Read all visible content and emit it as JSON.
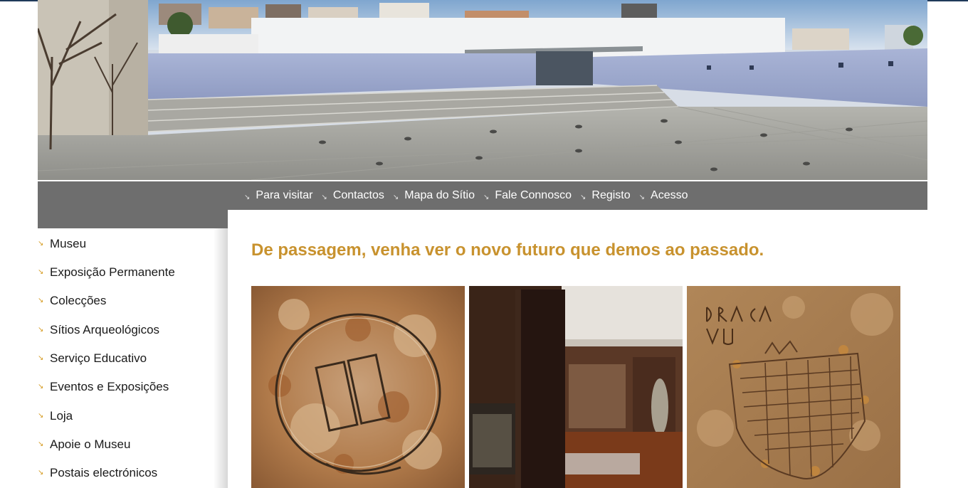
{
  "nav": {
    "items": [
      {
        "label": "Para visitar"
      },
      {
        "label": "Contactos"
      },
      {
        "label": "Mapa do Sítio"
      },
      {
        "label": "Fale Connosco"
      },
      {
        "label": "Registo"
      },
      {
        "label": "Acesso"
      }
    ],
    "bullet_icon": "arrow-bullet-icon"
  },
  "sidebar": {
    "items": [
      {
        "label": "Museu"
      },
      {
        "label": "Exposição Permanente"
      },
      {
        "label": "Colecções"
      },
      {
        "label": "Sítios Arqueológicos"
      },
      {
        "label": "Serviço Educativo"
      },
      {
        "label": "Eventos e Exposições"
      },
      {
        "label": "Loja"
      },
      {
        "label": "Apoie o Museu"
      },
      {
        "label": "Postais electrónicos"
      }
    ]
  },
  "main": {
    "headline": "De passagem, venha ver o novo futuro que demos ao passado."
  },
  "colors": {
    "nav_bg": "#6e6e6e",
    "headline": "#c8922e",
    "bullet": "#d59a1f",
    "top_line": "#1f3a5a"
  }
}
